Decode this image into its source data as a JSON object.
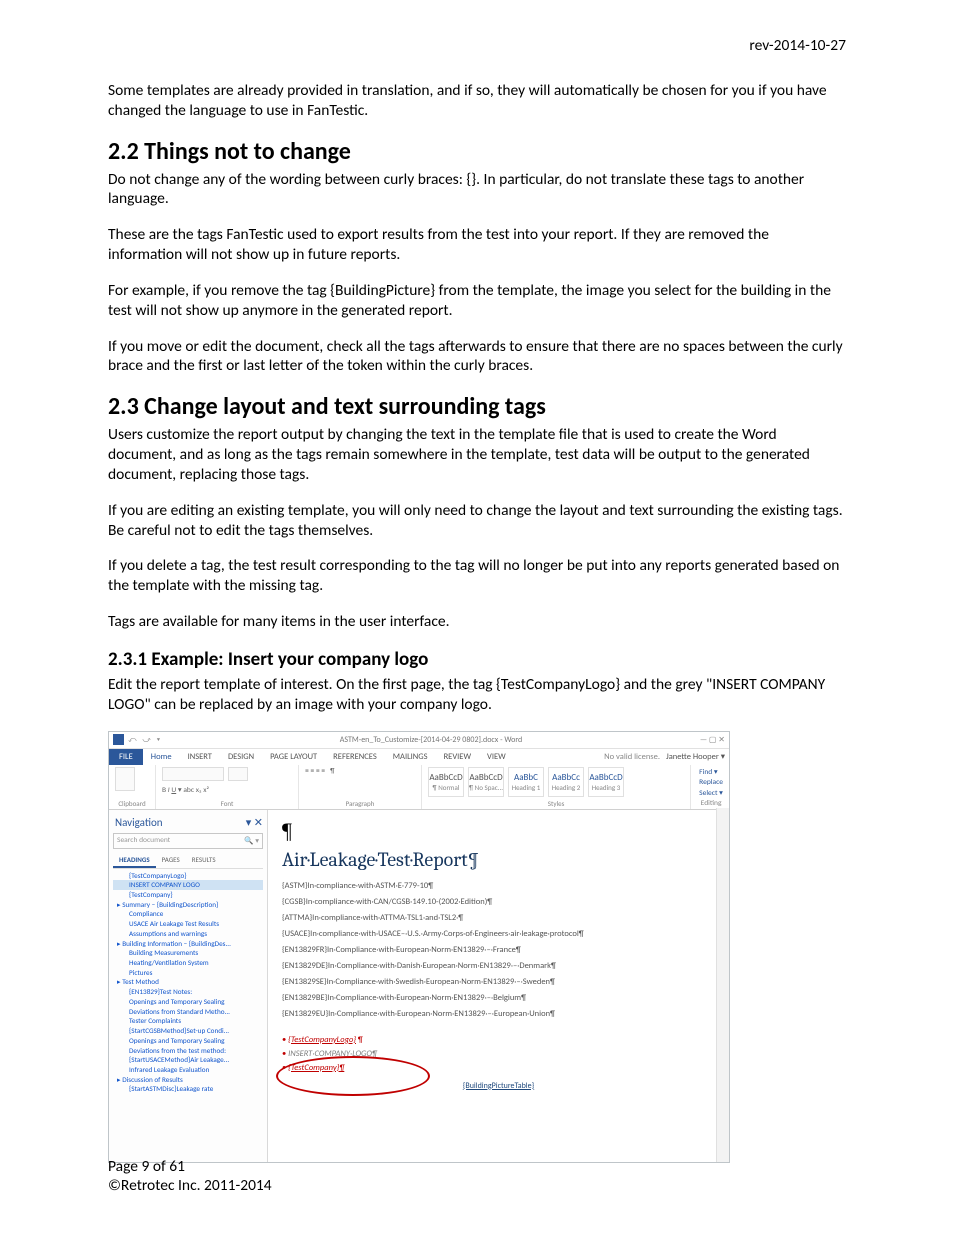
{
  "rev": "rev-2014-10-27",
  "intro": "Some templates are already provided in translation, and if so, they will automatically be chosen for you if you have changed the language to use in FanTestic.",
  "s22": {
    "heading": "2.2  Things not to change",
    "p1": "Do not change any of the wording between curly braces:  {}.  In particular, do not translate these tags to another language.",
    "p2": "These are the tags FanTestic used to export results from the test into your report.  If they are removed the information will not show up in future reports.",
    "p3": "For example,  if you remove the tag {BuildingPicture} from the template, the image you select for the building in the test will not show up anymore in the generated report.",
    "p4": "If you move or edit the document, check all the tags afterwards to ensure that there are no spaces between the curly brace and the first or last letter of the token within the curly braces."
  },
  "s23": {
    "heading": "2.3  Change layout and text surrounding tags",
    "p1": "Users customize the report output by changing the text in the template file that is used to create the Word document, and as long as the tags remain somewhere in the template, test data will be output to the generated document, replacing those tags.",
    "p2": "If you are editing an existing template, you will only need to change the layout and text surrounding the existing tags.  Be careful not to edit the tags themselves.",
    "p3": "If you delete a tag, the test result corresponding to the tag will no longer be put into any reports generated based on the template with the missing tag.",
    "p4": "Tags are available for many items in the user interface."
  },
  "s231": {
    "heading": "2.3.1  Example:  Insert your company logo",
    "p1": "Edit the report template of interest.  On the first page, the tag {TestCompanyLogo} and the grey \"INSERT COMPANY LOGO\" can be replaced by an image with your company logo."
  },
  "word": {
    "docname": "ASTM-en_To_Customize-[2014-04-29 0802].docx - Word",
    "license": "No valid license.",
    "user": "Janette Hooper ▾",
    "tabs": [
      "FILE",
      "Home",
      "INSERT",
      "DESIGN",
      "PAGE LAYOUT",
      "REFERENCES",
      "MAILINGS",
      "REVIEW",
      "VIEW"
    ],
    "groups": {
      "clipboard": "Clipboard",
      "font": "Font",
      "paragraph": "Paragraph",
      "styles": "Styles",
      "editing": "Editing"
    },
    "styleboxes": [
      "¶ Normal",
      "¶ No Spac...",
      "Heading 1",
      "Heading 2",
      "Heading 3"
    ],
    "editing": {
      "find": "Find ▾",
      "replace": "Replace",
      "select": "Select ▾"
    },
    "nav": {
      "title": "Navigation",
      "search": "Search document",
      "tabs": {
        "headings": "HEADINGS",
        "pages": "PAGES",
        "results": "RESULTS"
      },
      "tree": [
        {
          "l": 2,
          "t": "{TestCompanyLogo}"
        },
        {
          "l": 2,
          "t": "INSERT COMPANY LOGO",
          "hl": true
        },
        {
          "l": 2,
          "t": "{TestCompany}"
        },
        {
          "l": 1,
          "t": "▸ Summary – {BuildingDescription}"
        },
        {
          "l": 2,
          "t": "Compliance"
        },
        {
          "l": 2,
          "t": "USACE Air Leakage Test Results"
        },
        {
          "l": 2,
          "t": "Assumptions and warnings"
        },
        {
          "l": 1,
          "t": "▸ Building Information – {BuildingDes..."
        },
        {
          "l": 2,
          "t": "Building Measurements"
        },
        {
          "l": 2,
          "t": "Heating/Ventilation System"
        },
        {
          "l": 2,
          "t": "Pictures"
        },
        {
          "l": 1,
          "t": "▸ Test Method"
        },
        {
          "l": 2,
          "t": "{EN13829}Test Notes:"
        },
        {
          "l": 2,
          "t": "Openings and Temporary Sealing"
        },
        {
          "l": 2,
          "t": "Deviations from Standard Metho..."
        },
        {
          "l": 2,
          "t": "Tester Complaints"
        },
        {
          "l": 2,
          "t": "{StartCGSBMethod}Set-up Condi..."
        },
        {
          "l": 2,
          "t": "Openings and Temporary Sealing"
        },
        {
          "l": 2,
          "t": "Deviations from the test method:"
        },
        {
          "l": 2,
          "t": "{StartUSACEMethod}Air Leakage..."
        },
        {
          "l": 2,
          "t": "Infrared Leakage Evaluation"
        },
        {
          "l": 1,
          "t": "▸ Discussion of Results"
        },
        {
          "l": 2,
          "t": "{StartASTMDisc}Leakage rate"
        }
      ]
    },
    "doc": {
      "title": "Air·Leakage·Test·Report¶",
      "lines": [
        "{ASTM}In·compliance·with·ASTM·E·779-10¶",
        "{CGSB}In·compliance·with·CAN/CGSB·149.10-(2002·Edition)¶",
        "{ATTMA}In·compliance·with·ATTMA·TSL1·and·TSL2·¶",
        "{USACE}In·compliance·with·USACE–·U.S.·Army·Corps·of·Engineers·air·leakage·protocol¶",
        "{EN13829FR}In·Compliance·with·European·Norm·EN13829·–·France¶",
        "{EN13829DE}In·Compliance·with·Danish·European·Norm·EN13829·–·Denmark¶",
        "{EN13829SE}In·Compliance·with·Swedish·European·Norm·EN13829·–·Sweden¶",
        "{EN13829BE}In·Compliance·with·European·Norm·EN13829·–·Belgium¶",
        "{EN13829EU}In·Compliance·with·European·Norm·EN13829·–·European·Union¶"
      ],
      "bullet1": "{TestCompanyLogo}",
      "bullet2": "INSERT·COMPANY·LOGO¶",
      "bullet3": "{TestCompany}¶",
      "tablecap": "{BuildingPictureTable}"
    }
  },
  "footer": {
    "page": "Page 9 of 61",
    "copyright": "©Retrotec Inc. 2011-2014"
  }
}
